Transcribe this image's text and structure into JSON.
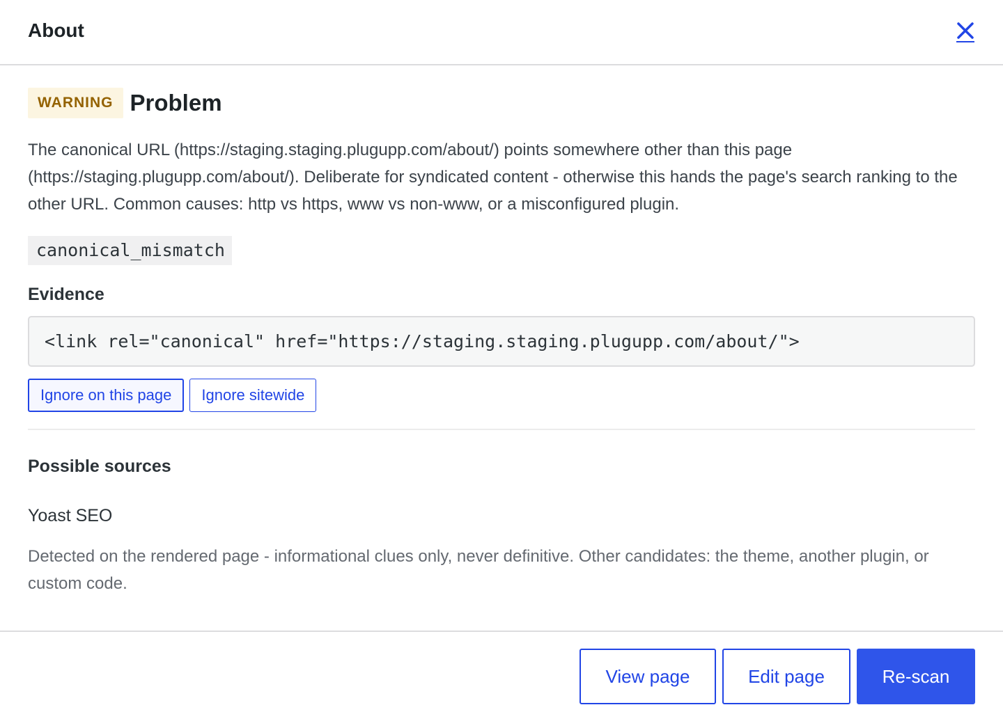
{
  "header": {
    "title": "About",
    "close_icon": "close-icon"
  },
  "problem": {
    "badge": "WARNING",
    "title": "Problem",
    "description": "The canonical URL (https://staging.staging.plugupp.com/about/) points somewhere other than this page (https://staging.plugupp.com/about/). Deliberate for syndicated content - otherwise this hands the page's search ranking to the other URL. Common causes: http vs https, www vs non-www, or a misconfigured plugin.",
    "code": "canonical_mismatch"
  },
  "evidence": {
    "label": "Evidence",
    "snippet": "<link rel=\"canonical\" href=\"https://staging.staging.plugupp.com/about/\">"
  },
  "ignore_actions": {
    "page": "Ignore on this page",
    "sitewide": "Ignore sitewide"
  },
  "sources": {
    "label": "Possible sources",
    "items": [
      "Yoast SEO"
    ],
    "note": "Detected on the rendered page - informational clues only, never definitive. Other candidates: the theme, another plugin, or custom code."
  },
  "footer": {
    "view_page": "View page",
    "edit_page": "Edit page",
    "rescan": "Re-scan"
  },
  "colors": {
    "accent": "#2145e6",
    "primary_button": "#2f55ea",
    "warning_bg": "#fcf5e1",
    "warning_text": "#946200"
  }
}
